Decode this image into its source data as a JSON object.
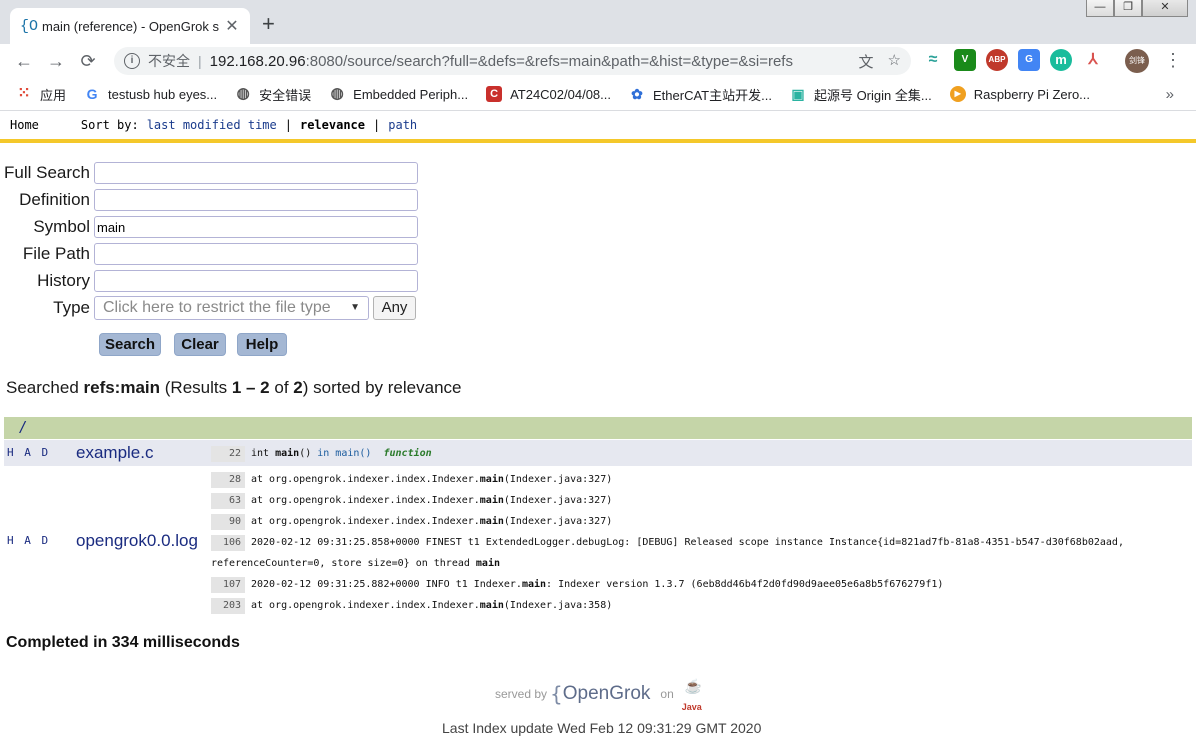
{
  "browser": {
    "tab_icon": "{O",
    "tab_title": "main (reference) - OpenGrok s",
    "tab_close": "✕",
    "new_tab": "+",
    "window_buttons": [
      "—",
      "❐",
      "✕"
    ],
    "nav_back": "←",
    "nav_forward": "→",
    "nav_reload": "⟳",
    "info_icon": "i",
    "insecure_label": "不安全",
    "url_host": "192.168.20.96",
    "url_rest": ":8080/source/search?full=&defs=&refs=main&path=&hist=&type=&si=refs",
    "translate_icon": "文",
    "star_icon": "☆",
    "extensions": [
      {
        "icon": "wave-icon",
        "text": "≈",
        "color": "#2aa198"
      },
      {
        "icon": "vim-icon",
        "text": "V",
        "color": "#1a8a1a"
      },
      {
        "icon": "abp-icon",
        "text": "ABP",
        "color": "#c0392b"
      },
      {
        "icon": "translate-ext-icon",
        "text": "G",
        "color": "#4285f4"
      },
      {
        "icon": "m-icon",
        "text": "m",
        "color": "#1abc9c"
      },
      {
        "icon": "pdf-icon",
        "text": "⅄",
        "color": "#d9534f"
      }
    ],
    "avatar_text": "剑锋",
    "menu_icon": "⋮",
    "bookmarks": [
      {
        "label": "应用",
        "icon": "apps-icon",
        "glyph": "⁙",
        "color": "#e04b3a"
      },
      {
        "label": "testusb hub eyes...",
        "icon": "google-icon",
        "glyph": "G",
        "color": "#4285f4"
      },
      {
        "label": "安全错误",
        "icon": "globe-icon",
        "glyph": "◍",
        "color": "#555555"
      },
      {
        "label": "Embedded Periph...",
        "icon": "globe-icon",
        "glyph": "◍",
        "color": "#555555"
      },
      {
        "label": "AT24C02/04/08...",
        "icon": "csdn-icon",
        "glyph": "C",
        "color": "#c9302c"
      },
      {
        "label": "EtherCAT主站开发...",
        "icon": "paw-icon",
        "glyph": "✿",
        "color": "#2f6fd8"
      },
      {
        "label": "起源号 Origin 全集...",
        "icon": "tv-icon",
        "glyph": "▣",
        "color": "#2bb3a1"
      },
      {
        "label": "Raspberry Pi Zero...",
        "icon": "play-icon",
        "glyph": "▶",
        "color": "#f0a020"
      }
    ],
    "bookmarks_more": "»"
  },
  "nav": {
    "home": "Home",
    "sort_by": "Sort by:",
    "sort_last_modified": "last modified time",
    "sort_relevance": "relevance",
    "sort_path": "path",
    "separator": "|"
  },
  "form": {
    "full_search_label": "Full Search",
    "full_search_value": "",
    "definition_label": "Definition",
    "definition_value": "",
    "symbol_label": "Symbol",
    "symbol_value": "main",
    "file_path_label": "File Path",
    "file_path_value": "",
    "history_label": "History",
    "history_value": "",
    "type_label": "Type",
    "type_placeholder": "Click here to restrict the file type",
    "type_caret": "▼",
    "any_button": "Any",
    "search_button": "Search",
    "clear_button": "Clear",
    "help_button": "Help"
  },
  "summary": {
    "prefix": "Searched ",
    "query": "refs:main",
    "results_open": " (Results ",
    "range": "1 – 2",
    "of": " of ",
    "total": "2",
    "suffix": ") sorted by relevance"
  },
  "results": {
    "directory": "/",
    "files": [
      {
        "had": "H A D",
        "name": "example.c",
        "lines": [
          {
            "no": "22",
            "pre": "int ",
            "bold": "main",
            "post": "()  ",
            "ref": "in main()",
            "tag": "function"
          }
        ]
      },
      {
        "had": "H A D",
        "name": "opengrok0.0.log",
        "lines": [
          {
            "no": "28",
            "pre": "at org.opengrok.indexer.index.Indexer.",
            "bold": "main",
            "post": "(Indexer.java:327)"
          },
          {
            "no": "63",
            "pre": "at org.opengrok.indexer.index.Indexer.",
            "bold": "main",
            "post": "(Indexer.java:327)"
          },
          {
            "no": "90",
            "pre": "at org.opengrok.indexer.index.Indexer.",
            "bold": "main",
            "post": "(Indexer.java:327)"
          },
          {
            "no": "106",
            "pre": "2020-02-12 09:31:25.858+0000 FINEST t1 ExtendedLogger.debugLog: [DEBUG] Released scope instance Instance{id=821ad7fb-81a8-4351-b547-d30f68b02aad,",
            "bold": "",
            "post": ""
          },
          {
            "no": "",
            "pre": "referenceCounter=0, store size=0} on thread ",
            "bold": "main",
            "post": ""
          },
          {
            "no": "107",
            "pre": "2020-02-12 09:31:25.882+0000 INFO t1 Indexer.",
            "bold": "main",
            "post": ": Indexer version 1.3.7 (6eb8dd46b4f2d0fd90d9aee05e6a8b5f676279f1)"
          },
          {
            "no": "203",
            "pre": "at org.opengrok.indexer.index.Indexer.",
            "bold": "main",
            "post": "(Indexer.java:358)"
          }
        ]
      }
    ]
  },
  "footer": {
    "completed": "Completed in 334 milliseconds",
    "served_by": "served by",
    "brace": "{",
    "brand": "OpenGrok",
    "on": "on",
    "java": "Java",
    "last_index": "Last Index update Wed Feb 12 09:31:29 GMT 2020"
  }
}
